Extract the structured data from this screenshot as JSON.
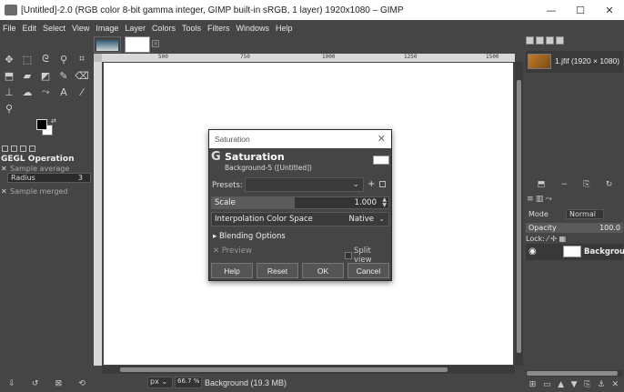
{
  "window": {
    "title": "[Untitled]-2.0 (RGB color 8-bit gamma integer, GIMP built-in sRGB, 1 layer) 1920x1080 – GIMP",
    "minimize": "—",
    "maximize": "☐",
    "close": "✕"
  },
  "menubar": {
    "items": [
      "File",
      "Edit",
      "Select",
      "View",
      "Image",
      "Layer",
      "Colors",
      "Tools",
      "Filters",
      "Windows",
      "Help"
    ]
  },
  "rulers": {
    "top_ticks": [
      "500",
      "750",
      "1000",
      "1250",
      "1500"
    ],
    "left_ticks": [
      "2",
      "5",
      "0",
      "7",
      "5",
      "0",
      "0",
      "0",
      "2"
    ]
  },
  "tool_options": {
    "title": "GEGL Operation",
    "sample_average": "Sample average",
    "radius_label": "Radius",
    "radius_value": "3",
    "sample_merged": "Sample merged"
  },
  "status": {
    "unit": "px",
    "zoom": "66.7 %",
    "text": "Background (19.3 MB)"
  },
  "images_panel": {
    "item_label": "1.jfif (1920 × 1080)"
  },
  "layers_panel": {
    "mode_label": "Mode",
    "mode_value": "Normal",
    "opacity_label": "Opacity",
    "opacity_value": "100.0",
    "lock_label": "Lock:",
    "layer_name": "Background"
  },
  "dialog": {
    "window_title": "Saturation",
    "heading": "Saturation",
    "subheading": "Background-5 ([Untitled])",
    "presets_label": "Presets:",
    "scale_label": "Scale",
    "scale_value": "1.000",
    "scale_fraction": 0.47,
    "interp_label": "Interpolation Color Space",
    "interp_value": "Native",
    "blending_options": "Blending Options",
    "preview_label": "Preview",
    "split_view_label": "Split view",
    "buttons": {
      "help": "Help",
      "reset": "Reset",
      "ok": "OK",
      "cancel": "Cancel"
    }
  }
}
